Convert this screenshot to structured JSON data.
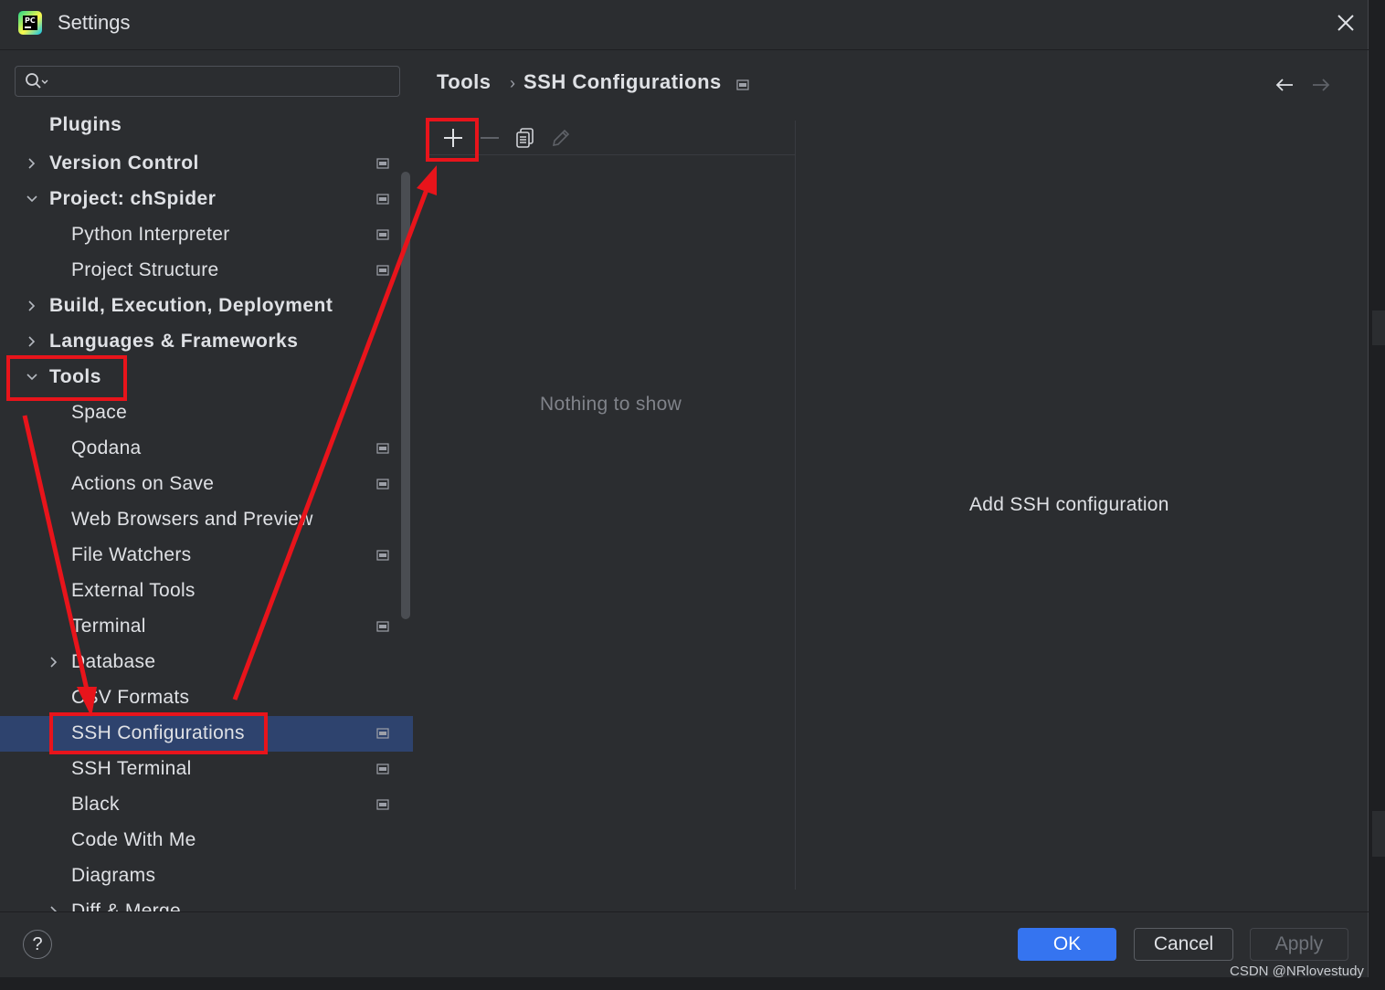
{
  "window": {
    "title": "Settings"
  },
  "search": {
    "placeholder": "",
    "value": ""
  },
  "tree": {
    "items": [
      {
        "label": "Plugins"
      },
      {
        "label": "Version Control"
      },
      {
        "label": "Project: chSpider"
      },
      {
        "label": "Python Interpreter"
      },
      {
        "label": "Project Structure"
      },
      {
        "label": "Build, Execution, Deployment"
      },
      {
        "label": "Languages & Frameworks"
      },
      {
        "label": "Tools"
      },
      {
        "label": "Space"
      },
      {
        "label": "Qodana"
      },
      {
        "label": "Actions on Save"
      },
      {
        "label": "Web Browsers and Preview"
      },
      {
        "label": "File Watchers"
      },
      {
        "label": "External Tools"
      },
      {
        "label": "Terminal"
      },
      {
        "label": "Database"
      },
      {
        "label": "CSV Formats"
      },
      {
        "label": "SSH Configurations"
      },
      {
        "label": "SSH Terminal"
      },
      {
        "label": "Black"
      },
      {
        "label": "Code With Me"
      },
      {
        "label": "Diagrams"
      },
      {
        "label": "Diff & Merge"
      }
    ]
  },
  "breadcrumb": {
    "parent": "Tools",
    "separator": "›",
    "current": "SSH Configurations"
  },
  "list": {
    "empty_text": "Nothing to show"
  },
  "detail": {
    "text": "Add SSH configuration"
  },
  "footer": {
    "help": "?",
    "ok": "OK",
    "cancel": "Cancel",
    "apply": "Apply"
  },
  "watermark": "CSDN @NRlovestudy",
  "colors": {
    "accent": "#3574f0",
    "selection": "#2e436e",
    "annotation": "#e8141b",
    "background": "#2b2d30"
  }
}
